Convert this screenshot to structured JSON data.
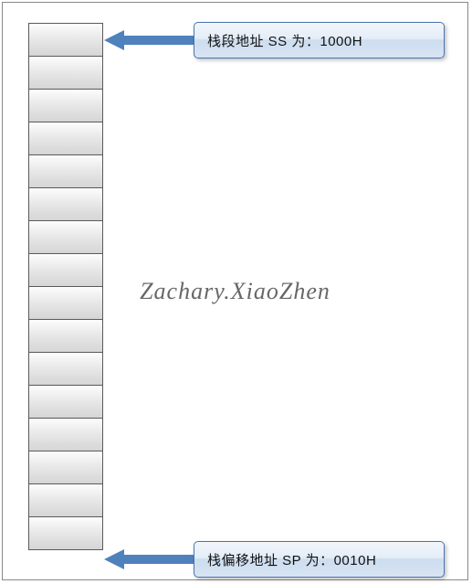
{
  "stack": {
    "cell_count": 16
  },
  "labels": {
    "top": "栈段地址 SS 为：1000H",
    "bottom": "栈偏移地址 SP 为：0010H"
  },
  "watermark": "Zachary.XiaoZhen",
  "colors": {
    "accent": "#4f81bd"
  }
}
